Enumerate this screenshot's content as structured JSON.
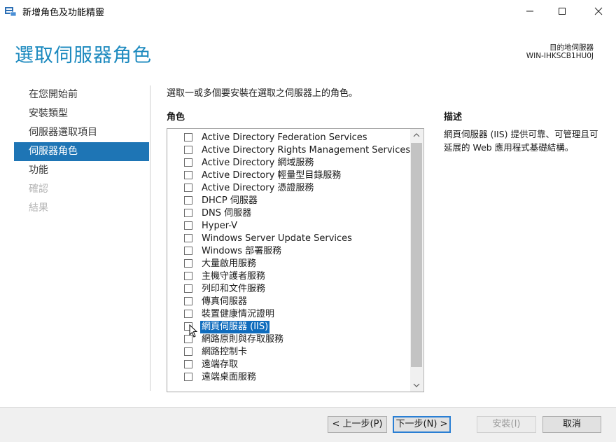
{
  "window": {
    "title": "新增角色及功能精靈"
  },
  "header": {
    "title": "選取伺服器角色",
    "destination_label": "目的地伺服器",
    "destination_value": "WIN-IHKSCB1HU0J"
  },
  "nav": {
    "items": [
      {
        "label": "在您開始前",
        "state": "normal"
      },
      {
        "label": "安裝類型",
        "state": "normal"
      },
      {
        "label": "伺服器選取項目",
        "state": "normal"
      },
      {
        "label": "伺服器角色",
        "state": "active"
      },
      {
        "label": "功能",
        "state": "normal"
      },
      {
        "label": "確認",
        "state": "disabled"
      },
      {
        "label": "結果",
        "state": "disabled"
      }
    ]
  },
  "main": {
    "instruction": "選取一或多個要安裝在選取之伺服器上的角色。",
    "roles_heading": "角色",
    "description_heading": "描述",
    "description_text": "網頁伺服器 (IIS) 提供可靠、可管理且可延展的 Web 應用程式基礎結構。",
    "roles": [
      {
        "label": "Active Directory Federation Services",
        "checked": false,
        "selected": false
      },
      {
        "label": "Active Directory Rights Management Services",
        "checked": false,
        "selected": false
      },
      {
        "label": "Active Directory 網域服務",
        "checked": false,
        "selected": false
      },
      {
        "label": "Active Directory 輕量型目錄服務",
        "checked": false,
        "selected": false
      },
      {
        "label": "Active Directory 憑證服務",
        "checked": false,
        "selected": false
      },
      {
        "label": "DHCP 伺服器",
        "checked": false,
        "selected": false
      },
      {
        "label": "DNS 伺服器",
        "checked": false,
        "selected": false
      },
      {
        "label": "Hyper-V",
        "checked": false,
        "selected": false
      },
      {
        "label": "Windows Server Update Services",
        "checked": false,
        "selected": false
      },
      {
        "label": "Windows 部署服務",
        "checked": false,
        "selected": false
      },
      {
        "label": "大量啟用服務",
        "checked": false,
        "selected": false
      },
      {
        "label": "主機守護者服務",
        "checked": false,
        "selected": false
      },
      {
        "label": "列印和文件服務",
        "checked": false,
        "selected": false
      },
      {
        "label": "傳真伺服器",
        "checked": false,
        "selected": false
      },
      {
        "label": "裝置健康情況證明",
        "checked": false,
        "selected": false
      },
      {
        "label": "網頁伺服器 (IIS)",
        "checked": false,
        "selected": true
      },
      {
        "label": "網路原則與存取服務",
        "checked": false,
        "selected": false
      },
      {
        "label": "網路控制卡",
        "checked": false,
        "selected": false
      },
      {
        "label": "遠端存取",
        "checked": false,
        "selected": false
      },
      {
        "label": "遠端桌面服務",
        "checked": false,
        "selected": false
      }
    ]
  },
  "footer": {
    "prev_label": "< 上一步(P)",
    "next_label": "下一步(N) >",
    "install_label": "安裝(I)",
    "cancel_label": "取消"
  },
  "colors": {
    "accent": "#1e75b5",
    "header_title": "#1d8abf",
    "selection": "#0f6cbd"
  }
}
